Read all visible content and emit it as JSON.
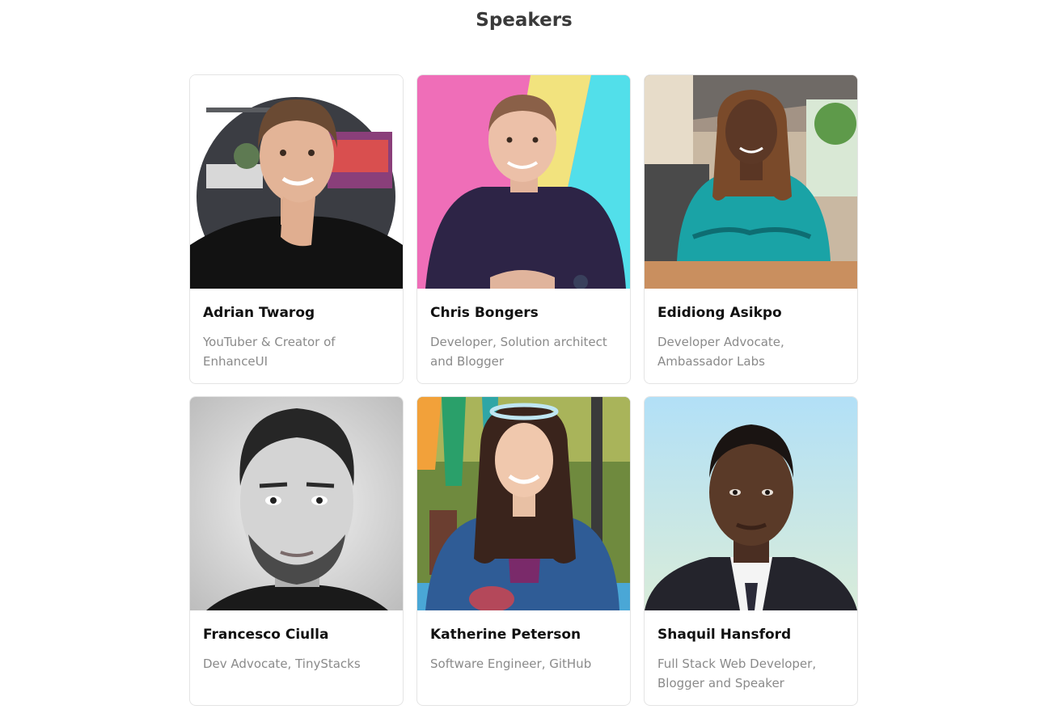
{
  "section": {
    "title": "Speakers"
  },
  "speakers": [
    {
      "name": "Adrian Twarog",
      "role": "YouTuber & Creator of EnhanceUI"
    },
    {
      "name": "Chris Bongers",
      "role": "Developer, Solution architect and Blogger"
    },
    {
      "name": "Edidiong Asikpo",
      "role": "Developer Advocate, Ambassador Labs"
    },
    {
      "name": "Francesco Ciulla",
      "role": "Dev Advocate, TinyStacks"
    },
    {
      "name": "Katherine Peterson",
      "role": "Software Engineer, GitHub"
    },
    {
      "name": "Shaquil Hansford",
      "role": "Full Stack Web Developer, Blogger and Speaker"
    }
  ]
}
